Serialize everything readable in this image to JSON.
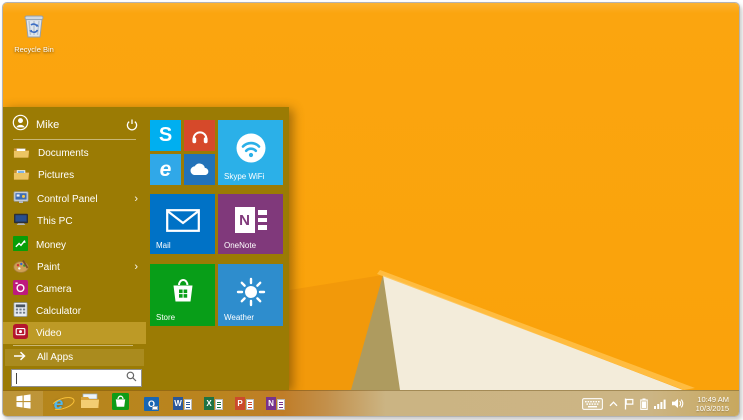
{
  "desktop": {
    "recycle_bin_label": "Recycle Bin"
  },
  "start_menu": {
    "user_name": "Mike",
    "submenu_glyph": "›",
    "all_apps_label": "All Apps",
    "search_value": "",
    "items": [
      {
        "label": "Documents",
        "icon": "documents-folder-icon"
      },
      {
        "label": "Pictures",
        "icon": "pictures-folder-icon"
      },
      {
        "label": "Control Panel",
        "icon": "control-panel-icon",
        "has_submenu": true
      },
      {
        "label": "This PC",
        "icon": "this-pc-icon"
      },
      {
        "label": "Money",
        "icon": "money-icon"
      },
      {
        "label": "Paint",
        "icon": "paint-icon",
        "has_submenu": true
      },
      {
        "label": "Camera",
        "icon": "camera-icon"
      },
      {
        "label": "Calculator",
        "icon": "calculator-icon"
      },
      {
        "label": "Video",
        "icon": "video-icon",
        "highlighted": true
      }
    ],
    "tiles": {
      "skype_glyph": "S",
      "ie_glyph": "e",
      "skype_wifi_label": "Skype WiFi",
      "mail_label": "Mail",
      "onenote_label": "OneNote",
      "onenote_glyph": "N",
      "store_label": "Store",
      "weather_label": "Weather",
      "icon_names": [
        "skype-icon",
        "headphones-icon",
        "internet-explorer-icon",
        "onedrive-cloud-icon",
        "skype-wifi-icon",
        "mail-envelope-icon",
        "onenote-icon",
        "store-bag-icon",
        "weather-sun-icon"
      ],
      "colors": {
        "skype": "#00aff0",
        "headphones": "#d6492a",
        "ie": "#30a8e8",
        "onedrive": "#2272b9",
        "skype_wifi": "#2bb0e8",
        "mail": "#0072c6",
        "onenote": "#80397b",
        "store": "#089e18",
        "weather": "#2e8dcd"
      }
    },
    "colors": {
      "menu_bg": "#9b7b04",
      "highlight_row": "#bd9a26",
      "all_apps_row": "#aa8b1e"
    }
  },
  "taskbar": {
    "app_icons": [
      "windows-start-icon",
      "internet-explorer-icon",
      "file-explorer-icon",
      "store-icon",
      "outlook-icon",
      "word-icon",
      "excel-icon",
      "powerpoint-icon",
      "onenote-icon"
    ],
    "ie_glyph": "e",
    "outlook_letter": "O",
    "word_letter": "W",
    "excel_letter": "X",
    "powerpoint_letter": "P",
    "onenote_letter": "N",
    "office_colors": {
      "word": "#2b579a",
      "excel": "#1f7244",
      "powerpoint": "#cb4a2c",
      "onenote": "#77338d"
    }
  },
  "tray": {
    "icon_names": [
      "keyboard-icon",
      "show-hidden-chevron-icon",
      "action-center-flag-icon",
      "battery-icon",
      "network-signal-icon",
      "volume-icon"
    ],
    "clock_time": "10:49 AM",
    "clock_date": "10/3/2015"
  },
  "wallpaper_colors": {
    "orange": "#faa20a",
    "cream_wedge": "#f3ecda",
    "khaki_shadow": "#ae9b5f",
    "taskbar_gold": "#b4861b"
  }
}
